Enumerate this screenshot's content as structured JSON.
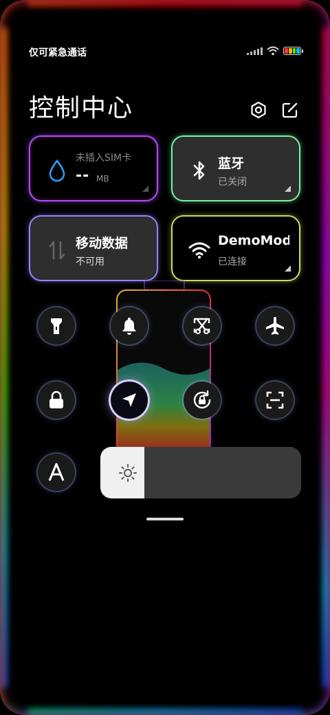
{
  "status_bar": {
    "carrier": "仅可紧急通话",
    "icons": [
      "signal-icon",
      "wifi-icon",
      "battery-icon"
    ]
  },
  "header": {
    "title": "控制中心",
    "buttons": [
      "settings-icon",
      "edit-icon"
    ]
  },
  "tiles": {
    "data_usage": {
      "title": "未插入SIM卡",
      "value": "--",
      "unit": "MB"
    },
    "bluetooth": {
      "title": "蓝牙",
      "status": "已关闭"
    },
    "mobile_data": {
      "title": "移动数据",
      "status": "不可用"
    },
    "wifi": {
      "title": "DemoMod",
      "status": "已连接"
    }
  },
  "toggles": [
    {
      "name": "flashlight",
      "icon": "flashlight-icon",
      "active": false
    },
    {
      "name": "mute",
      "icon": "bell-icon",
      "active": false
    },
    {
      "name": "screenshot",
      "icon": "scissors-icon",
      "active": false
    },
    {
      "name": "airplane-mode",
      "icon": "airplane-icon",
      "active": false
    },
    {
      "name": "lock-screen",
      "icon": "lock-icon",
      "active": false
    },
    {
      "name": "location",
      "icon": "location-arrow-icon",
      "active": true
    },
    {
      "name": "rotation-lock",
      "icon": "rotation-lock-icon",
      "active": false
    },
    {
      "name": "scanner",
      "icon": "scan-icon",
      "active": false
    },
    {
      "name": "auto-brightness",
      "icon": "letter-a-icon",
      "active": false
    }
  ],
  "brightness": {
    "level": 0.22,
    "icon": "sun-icon"
  },
  "colors": {
    "background": "#000000",
    "tile_dark": "#2e2e2e",
    "accent_blue": "#2a9df4"
  }
}
